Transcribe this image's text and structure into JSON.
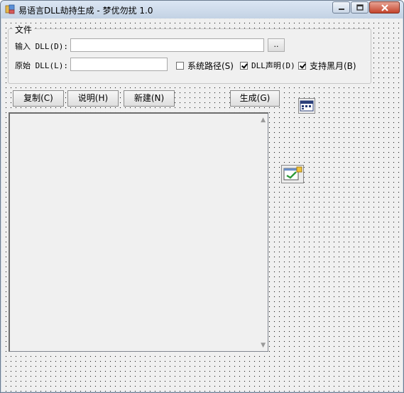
{
  "window": {
    "title": "易语言DLL劫持生成 - 梦优勿扰 1.0",
    "icons": [
      "app-icon",
      "minimize-icon",
      "maximize-icon",
      "close-icon"
    ]
  },
  "file_group": {
    "legend": "文件",
    "input_dll_label": "输入 DLL(D):",
    "input_dll_value": "",
    "browse_label": "..",
    "original_dll_label": "原始 DLL(L):",
    "original_dll_value": ""
  },
  "checkboxes": [
    {
      "label": "系统路径(S)",
      "checked": false
    },
    {
      "label": "DLL声明(D)",
      "checked": true
    },
    {
      "label": "支持黑月(B)",
      "checked": true
    }
  ],
  "buttons": {
    "copy": "复制(C)",
    "help": "说明(H)",
    "new": "新建(N)",
    "generate": "生成(G)"
  },
  "output": {
    "value": ""
  },
  "components": [
    "calendar-component-icon",
    "window-edit-component-icon"
  ]
}
